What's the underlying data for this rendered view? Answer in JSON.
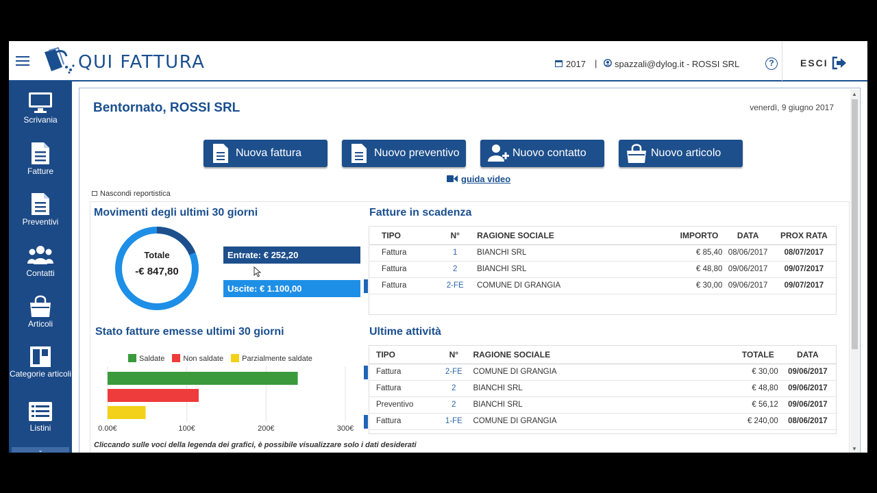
{
  "header": {
    "brand": "QUI FATTURA",
    "year": "2017",
    "separator": "|",
    "user": "spazzali@dylog.it - ROSSI SRL",
    "help": "?",
    "logout": "ESCI"
  },
  "sidebar": {
    "items": [
      {
        "label": "Scrivania",
        "icon": "monitor-icon"
      },
      {
        "label": "Fatture",
        "icon": "document-icon"
      },
      {
        "label": "Preventivi",
        "icon": "document-icon"
      },
      {
        "label": "Contatti",
        "icon": "users-icon"
      },
      {
        "label": "Articoli",
        "icon": "bag-icon"
      },
      {
        "label": "Categorie articoli",
        "icon": "layout-icon"
      },
      {
        "label": "Listini",
        "icon": "list-icon"
      }
    ]
  },
  "main": {
    "welcome": "Bentornato, ROSSI SRL",
    "date": "venerdì, 9 giugno 2017",
    "actions": [
      {
        "label": "Nuova fattura",
        "icon": "document-icon"
      },
      {
        "label": "Nuovo preventivo",
        "icon": "document-icon"
      },
      {
        "label": "Nuovo contatto",
        "icon": "add-user-icon"
      },
      {
        "label": "Nuovo articolo",
        "icon": "bag-icon"
      }
    ],
    "guide": "guida video",
    "hide_reports": "Nascondi reportistica"
  },
  "movements": {
    "title": "Movimenti degli ultimi 30 giorni",
    "total_label": "Totale",
    "total_value": "-€ 847,80",
    "income": "Entrate: € 252,20",
    "expense": "Uscite: € 1.100,00",
    "income_fraction": 0.187,
    "colors": {
      "income": "#1d4f8c",
      "expense": "#1e8fe6"
    }
  },
  "invoice_status": {
    "title": "Stato fatture emesse ultimi 30 giorni",
    "hint": "Cliccando sulle voci della legenda dei grafici, è possibile visualizzare solo i dati desiderati"
  },
  "chart_data": {
    "type": "bar",
    "orientation": "horizontal",
    "series": [
      {
        "name": "Saldate",
        "value": 240,
        "color": "#3a9a3c"
      },
      {
        "name": "Non saldate",
        "value": 115,
        "color": "#ee3b3b"
      },
      {
        "name": "Parzialmente saldate",
        "value": 48,
        "color": "#f3d11a"
      }
    ],
    "ticks": [
      "0.00€",
      "100€",
      "200€",
      "300€"
    ],
    "xlim": [
      0,
      300
    ],
    "legend": "top"
  },
  "due_invoices": {
    "title": "Fatture in scadenza",
    "columns": [
      "TIPO",
      "N°",
      "RAGIONE SOCIALE",
      "IMPORTO",
      "DATA",
      "PROX RATA"
    ],
    "rows": [
      {
        "type": "Fattura",
        "num": "1",
        "company": "BIANCHI SRL",
        "amount": "€ 85,40",
        "date": "08/06/2017",
        "next": "08/07/2017",
        "marked": false
      },
      {
        "type": "Fattura",
        "num": "2",
        "company": "BIANCHI SRL",
        "amount": "€ 48,80",
        "date": "09/06/2017",
        "next": "09/07/2017",
        "marked": false
      },
      {
        "type": "Fattura",
        "num": "2-FE",
        "company": "COMUNE DI GRANGIA",
        "amount": "€ 30,00",
        "date": "09/06/2017",
        "next": "09/07/2017",
        "marked": true
      }
    ]
  },
  "recent": {
    "title": "Ultime attività",
    "columns": [
      "TIPO",
      "N°",
      "RAGIONE SOCIALE",
      "TOTALE",
      "DATA"
    ],
    "rows": [
      {
        "type": "Fattura",
        "num": "2-FE",
        "company": "COMUNE DI GRANGIA",
        "total": "€ 30,00",
        "date": "09/06/2017",
        "marked": true
      },
      {
        "type": "Fattura",
        "num": "2",
        "company": "BIANCHI SRL",
        "total": "€ 48,80",
        "date": "09/06/2017",
        "marked": false
      },
      {
        "type": "Preventivo",
        "num": "2",
        "company": "BIANCHI SRL",
        "total": "€ 56,12",
        "date": "09/06/2017",
        "marked": false
      },
      {
        "type": "Fattura",
        "num": "1-FE",
        "company": "COMUNE DI GRANGIA",
        "total": "€ 240,00",
        "date": "08/06/2017",
        "marked": true
      }
    ]
  }
}
